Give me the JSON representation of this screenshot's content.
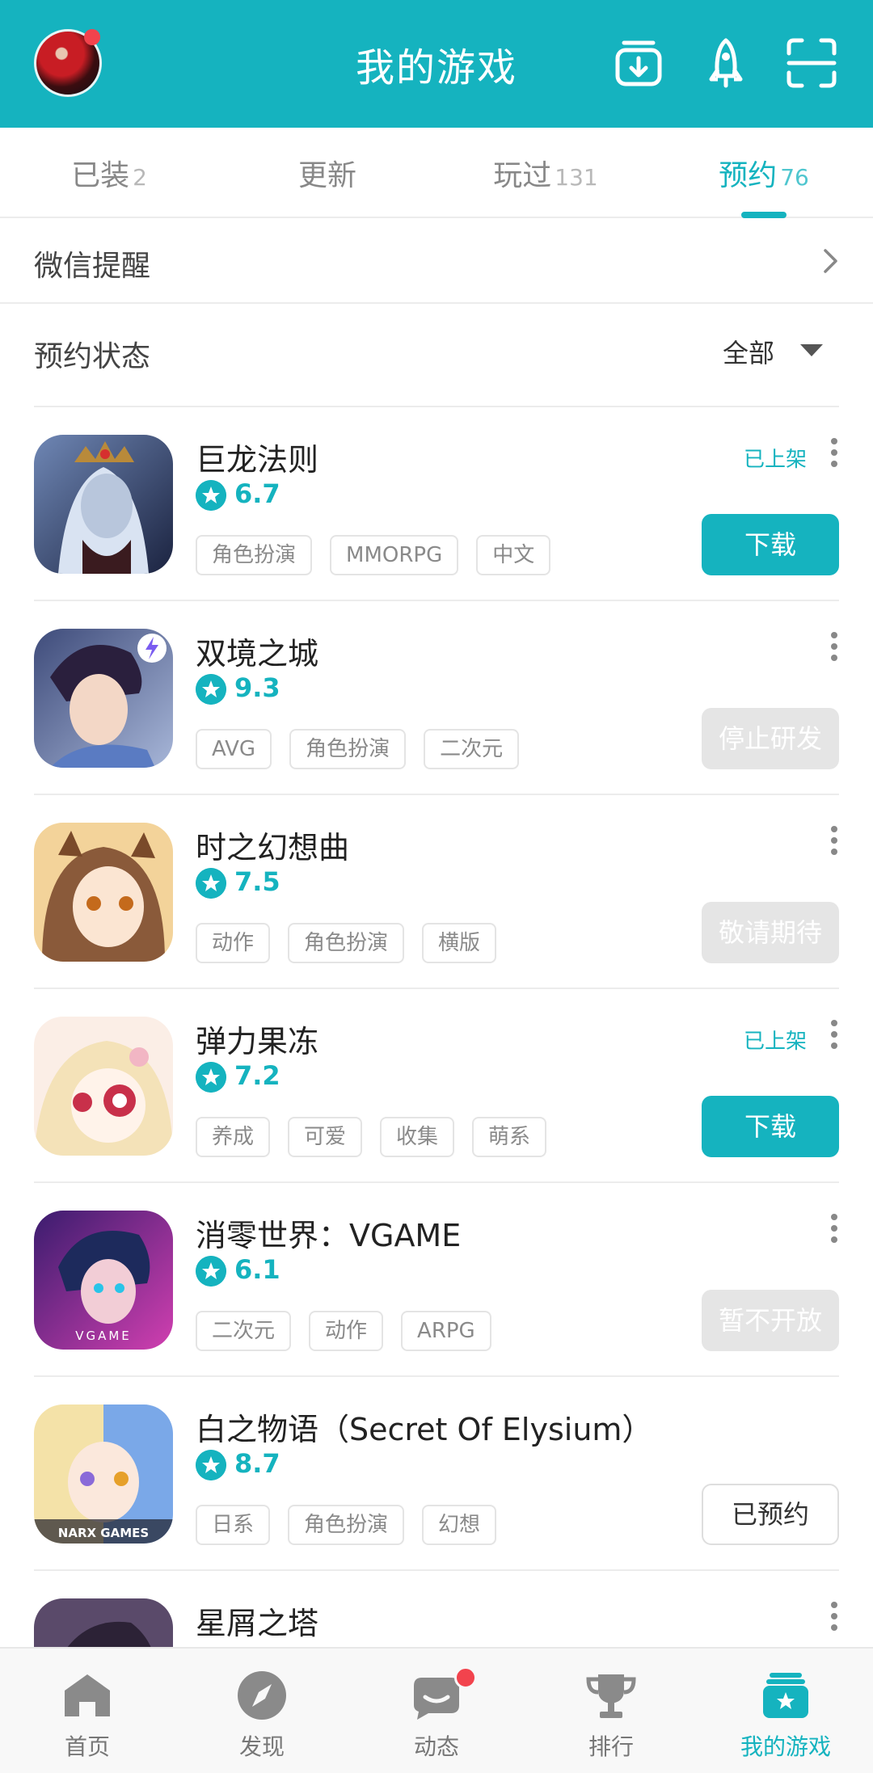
{
  "header": {
    "title": "我的游戏",
    "icons": [
      "download-manager-icon",
      "rocket-icon",
      "scan-icon"
    ]
  },
  "tabs": [
    {
      "label": "已装",
      "count": "2",
      "active": false
    },
    {
      "label": "更新",
      "count": "",
      "active": false
    },
    {
      "label": "玩过",
      "count": "131",
      "active": false
    },
    {
      "label": "预约",
      "count": "76",
      "active": true
    }
  ],
  "wechat_reminder": {
    "label": "微信提醒"
  },
  "reservation_status": {
    "label": "预约状态",
    "filter_value": "全部"
  },
  "games": [
    {
      "name": "巨龙法则",
      "rating": "6.7",
      "tags": [
        "角色扮演",
        "MMORPG",
        "中文"
      ],
      "status": "已上架",
      "action": "下载",
      "action_type": "primary"
    },
    {
      "name": "双境之城",
      "rating": "9.3",
      "tags": [
        "AVG",
        "角色扮演",
        "二次元"
      ],
      "status": "",
      "action": "停止研发",
      "action_type": "disabled"
    },
    {
      "name": "时之幻想曲",
      "rating": "7.5",
      "tags": [
        "动作",
        "角色扮演",
        "横版"
      ],
      "status": "",
      "action": "敬请期待",
      "action_type": "disabled"
    },
    {
      "name": "弹力果冻",
      "rating": "7.2",
      "tags": [
        "养成",
        "可爱",
        "收集",
        "萌系"
      ],
      "status": "已上架",
      "action": "下载",
      "action_type": "primary"
    },
    {
      "name": "消零世界：VGAME",
      "rating": "6.1",
      "tags": [
        "二次元",
        "动作",
        "ARPG"
      ],
      "status": "",
      "action": "暂不开放",
      "action_type": "disabled"
    },
    {
      "name": "白之物语（Secret Of Elysium）",
      "rating": "8.7",
      "tags": [
        "日系",
        "角色扮演",
        "幻想"
      ],
      "status": "",
      "action": "已预约",
      "action_type": "outline"
    },
    {
      "name": "星屑之塔",
      "rating": "",
      "tags": [],
      "status": "",
      "action": "",
      "action_type": "none"
    }
  ],
  "icon_texts": {
    "vgame": "VGAME",
    "narx": "NARX GAMES"
  },
  "bottom_nav": [
    {
      "label": "首页",
      "icon": "home-icon",
      "active": false
    },
    {
      "label": "发现",
      "icon": "compass-icon",
      "active": false
    },
    {
      "label": "动态",
      "icon": "chat-icon",
      "active": false,
      "badge": true
    },
    {
      "label": "排行",
      "icon": "trophy-icon",
      "active": false
    },
    {
      "label": "我的游戏",
      "icon": "my-games-icon",
      "active": true
    }
  ],
  "colors": {
    "accent": "#15b3bf",
    "badge": "#f2434d"
  }
}
